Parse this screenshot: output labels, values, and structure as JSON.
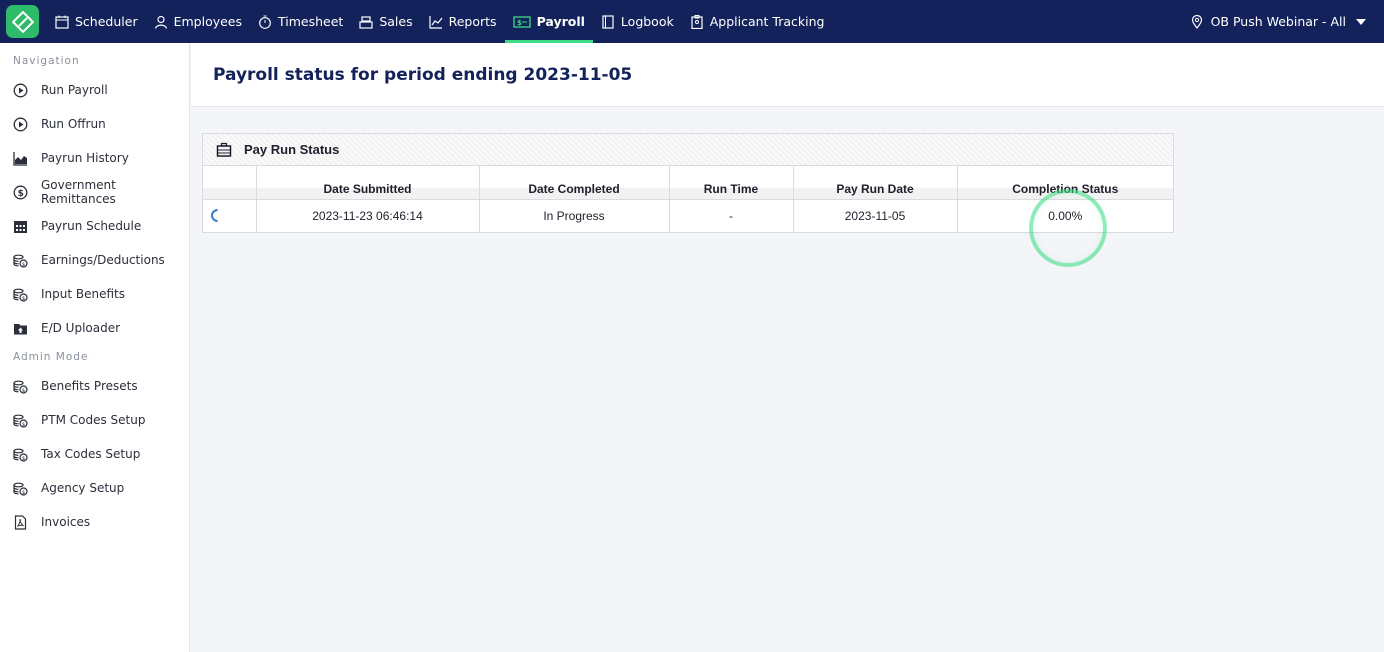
{
  "topnav": {
    "items": [
      {
        "label": "Scheduler",
        "icon": "calendar-icon"
      },
      {
        "label": "Employees",
        "icon": "person-icon"
      },
      {
        "label": "Timesheet",
        "icon": "stopwatch-icon"
      },
      {
        "label": "Sales",
        "icon": "register-icon"
      },
      {
        "label": "Reports",
        "icon": "chart-icon"
      },
      {
        "label": "Payroll",
        "icon": "payroll-icon",
        "active": true
      },
      {
        "label": "Logbook",
        "icon": "book-icon"
      },
      {
        "label": "Applicant Tracking",
        "icon": "clipboard-icon"
      }
    ],
    "location": "OB Push Webinar - All"
  },
  "sidebar": {
    "navigation_label": "Navigation",
    "navigation": [
      {
        "label": "Run Payroll",
        "icon": "play-circle-icon"
      },
      {
        "label": "Run Offrun",
        "icon": "play-circle-icon"
      },
      {
        "label": "Payrun History",
        "icon": "area-chart-icon"
      },
      {
        "label": "Government Remittances",
        "icon": "dollar-circle-icon"
      },
      {
        "label": "Payrun Schedule",
        "icon": "calendar-grid-icon"
      },
      {
        "label": "Earnings/Deductions",
        "icon": "coins-icon"
      },
      {
        "label": "Input Benefits",
        "icon": "coins-icon"
      },
      {
        "label": "E/D Uploader",
        "icon": "folder-upload-icon"
      }
    ],
    "admin_label": "Admin Mode",
    "admin": [
      {
        "label": "Benefits Presets",
        "icon": "coins-icon"
      },
      {
        "label": "PTM Codes Setup",
        "icon": "coins-icon"
      },
      {
        "label": "Tax Codes Setup",
        "icon": "coins-icon"
      },
      {
        "label": "Agency Setup",
        "icon": "coins-icon"
      },
      {
        "label": "Invoices",
        "icon": "pdf-icon"
      }
    ]
  },
  "page": {
    "title": "Payroll status for period ending 2023-11-05"
  },
  "panel": {
    "title": "Pay Run Status",
    "columns": [
      "",
      "Date Submitted",
      "Date Completed",
      "Run Time",
      "Pay Run Date",
      "Completion Status"
    ],
    "rows": [
      {
        "date_submitted": "2023-11-23 06:46:14",
        "date_completed": "In Progress",
        "run_time": "-",
        "pay_run_date": "2023-11-05",
        "completion_status": "0.00%"
      }
    ]
  },
  "colors": {
    "topbar": "#13225a",
    "accent": "#3ddc84",
    "logo": "#2dbb6a"
  }
}
